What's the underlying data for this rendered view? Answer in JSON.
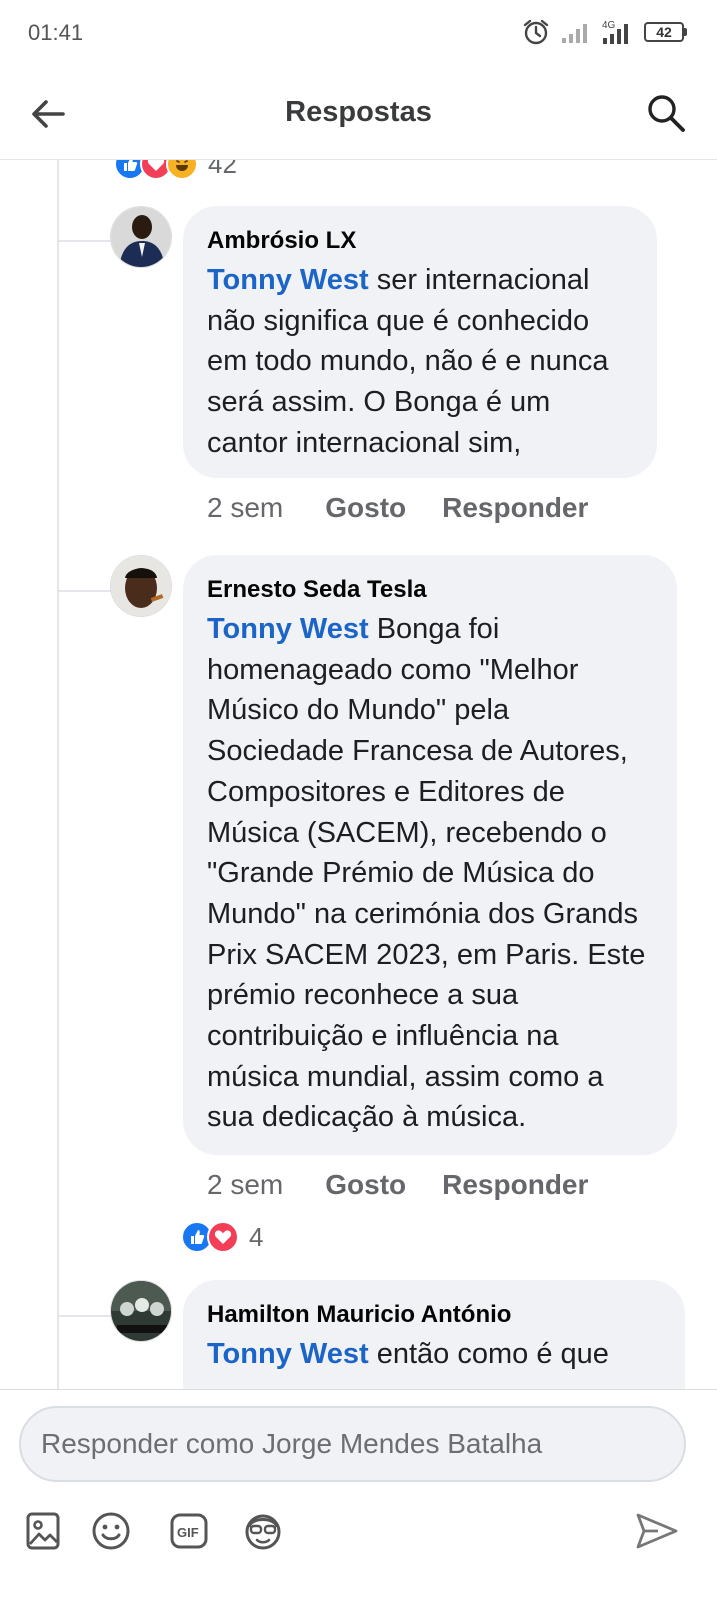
{
  "status_bar": {
    "time": "01:41",
    "battery": "42",
    "network": "4G"
  },
  "header": {
    "title": "Respostas"
  },
  "top_reactions": {
    "count": "42"
  },
  "comments": [
    {
      "author": "Ambrósio LX",
      "mention": "Tonny West",
      "text": " ser internacional não significa que é conhecido em todo mundo, não é e nunca será assim. O Bonga é um cantor internacional sim,",
      "time": "2 sem",
      "like_label": "Gosto",
      "reply_label": "Responder"
    },
    {
      "author": "Ernesto Seda Tesla",
      "mention": "Tonny West",
      "text": " Bonga foi homenageado como \"Melhor Músico do Mundo\" pela Sociedade Francesa de Autores, Compositores e Editores de Música (SACEM), recebendo o \"Grande Prémio de Música do Mundo\" na cerimónia dos Grands Prix SACEM 2023, em Paris. Este prémio reconhece a sua contribuição e influência na música mundial, assim como a sua dedicação à música.",
      "time": "2 sem",
      "like_label": "Gosto",
      "reply_label": "Responder",
      "reaction_count": "4"
    },
    {
      "author": "Hamilton Mauricio António",
      "mention": "Tonny West",
      "text": " então como é que"
    }
  ],
  "footer": {
    "reply_placeholder": "Responder como Jorge Mendes Batalha",
    "tools": [
      "image-icon",
      "emoji-icon",
      "gif-icon",
      "avatar-sticker-icon",
      "send-icon"
    ]
  },
  "colors": {
    "mention": "#1b64c8",
    "bubble": "#f0f2f5",
    "like": "#1877f2",
    "love": "#f33e58",
    "haha": "#f7b125"
  }
}
